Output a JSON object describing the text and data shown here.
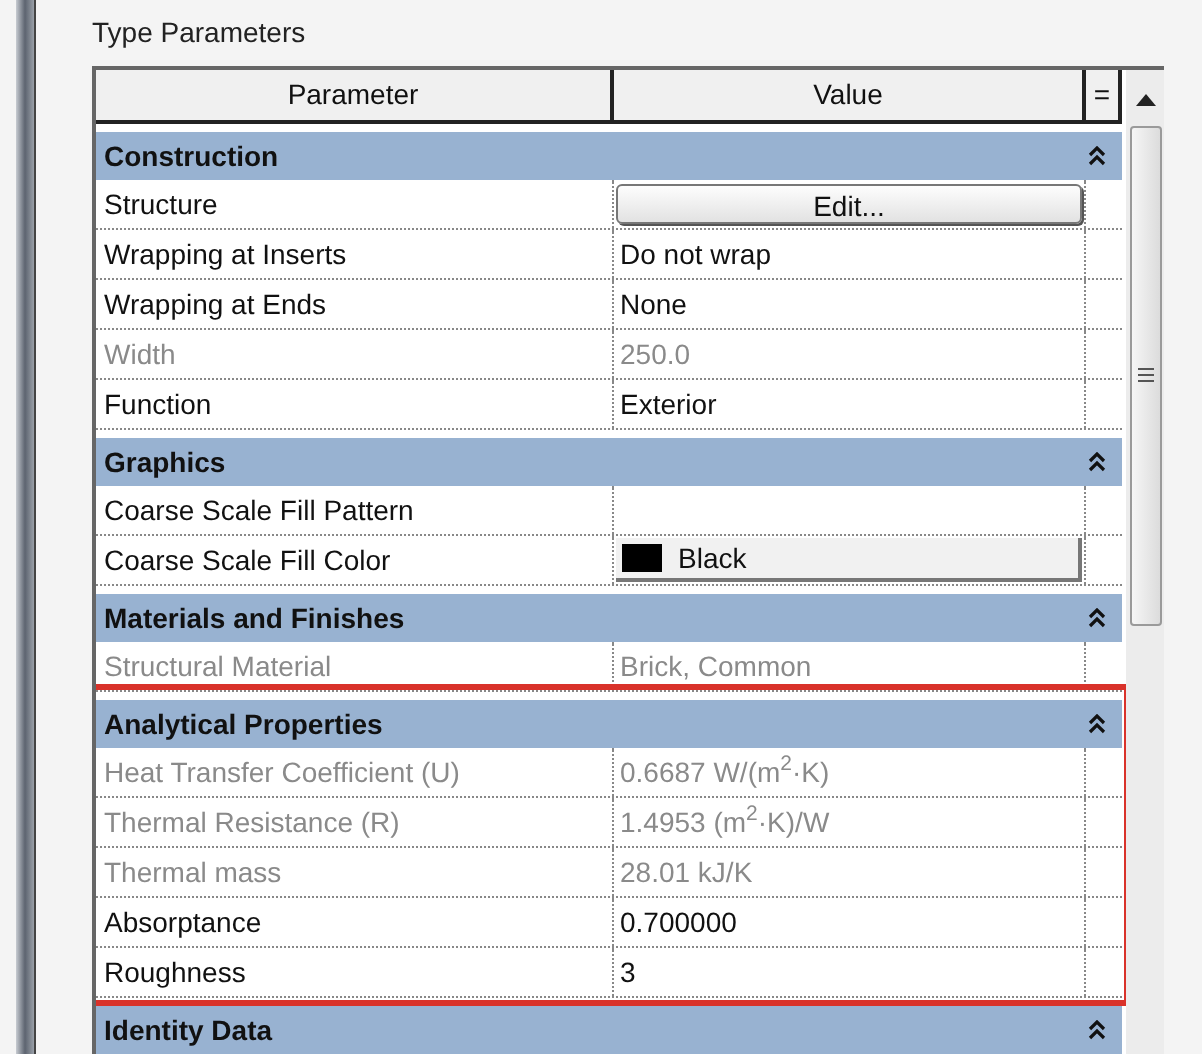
{
  "title": "Type Parameters",
  "columns": [
    "Parameter",
    "Value",
    "="
  ],
  "groups": [
    {
      "title": "Construction",
      "expanded": true,
      "highlighted": false,
      "rows": [
        {
          "name": "Structure",
          "value": "Edit...",
          "kind": "button",
          "disabled": false
        },
        {
          "name": "Wrapping at Inserts",
          "value": "Do not wrap",
          "kind": "text",
          "disabled": false
        },
        {
          "name": "Wrapping at Ends",
          "value": "None",
          "kind": "text",
          "disabled": false
        },
        {
          "name": "Width",
          "value": "250.0",
          "kind": "text",
          "disabled": true
        },
        {
          "name": "Function",
          "value": "Exterior",
          "kind": "text",
          "disabled": false
        }
      ]
    },
    {
      "title": "Graphics",
      "expanded": true,
      "highlighted": false,
      "rows": [
        {
          "name": "Coarse Scale Fill Pattern",
          "kind": "text",
          "disabled": false
        },
        {
          "name": "Coarse Scale Fill Color",
          "value": "Black",
          "kind": "color",
          "color": "#000000",
          "disabled": false
        }
      ]
    },
    {
      "title": "Materials and Finishes",
      "expanded": true,
      "highlighted": false,
      "rows": [
        {
          "name": "Structural Material",
          "value": "Brick, Common",
          "kind": "text",
          "disabled": true
        }
      ]
    },
    {
      "title": "Analytical Properties",
      "expanded": true,
      "highlighted": true,
      "rows": [
        {
          "name": "Heat Transfer Coefficient (U)",
          "value": "0.6687 W/(m$^{2}$·K)",
          "kind": "text",
          "disabled": true
        },
        {
          "name": "Thermal Resistance (R)",
          "value": "1.4953 (m$^{2}$·K)/W",
          "kind": "text",
          "disabled": true
        },
        {
          "name": "Thermal mass",
          "value": "28.01 kJ/K",
          "kind": "text",
          "disabled": true
        },
        {
          "name": "Absorptance",
          "value": "0.700000",
          "kind": "text",
          "disabled": false
        },
        {
          "name": "Roughness",
          "value": "3",
          "kind": "text",
          "disabled": false
        }
      ]
    },
    {
      "title": "Identity Data",
      "expanded": true,
      "highlighted": false
    }
  ]
}
